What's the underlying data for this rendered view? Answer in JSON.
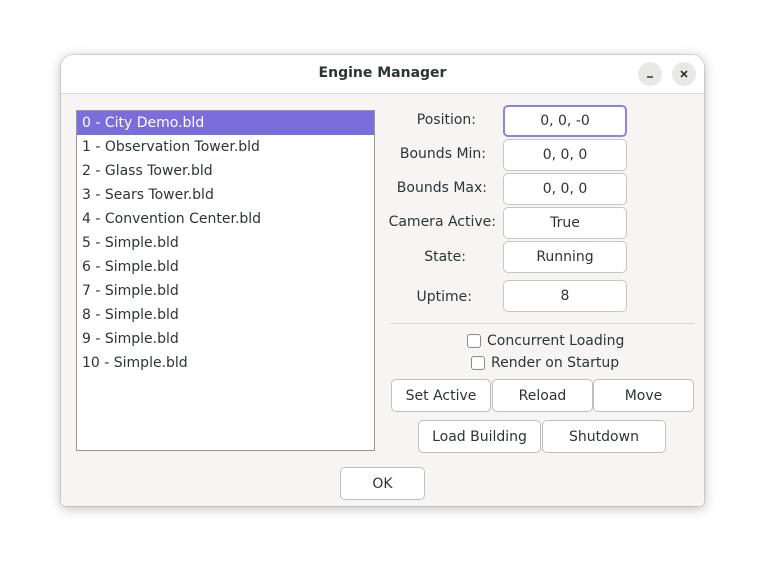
{
  "window": {
    "title": "Engine Manager",
    "minimize_icon": "minimize-icon",
    "close_icon": "close-icon"
  },
  "buildings": [
    "0 - City Demo.bld",
    "1 - Observation Tower.bld",
    "2 - Glass Tower.bld",
    "3 - Sears Tower.bld",
    "4 - Convention Center.bld",
    "5 - Simple.bld",
    "6 - Simple.bld",
    "7 - Simple.bld",
    "8 - Simple.bld",
    "9 - Simple.bld",
    "10 - Simple.bld"
  ],
  "selected_index": 0,
  "properties": {
    "position": {
      "label": "Position:",
      "value": "0, 0, -0"
    },
    "bounds_min": {
      "label": "Bounds Min:",
      "value": "0, 0, 0"
    },
    "bounds_max": {
      "label": "Bounds Max:",
      "value": "0, 0, 0"
    },
    "camera_active": {
      "label": "Camera Active:",
      "value": "True"
    },
    "state": {
      "label": "State:",
      "value": "Running"
    },
    "uptime": {
      "label": "Uptime:",
      "value": "8"
    }
  },
  "options": {
    "concurrent_loading": {
      "label": "Concurrent Loading",
      "checked": false
    },
    "render_on_startup": {
      "label": "Render on Startup",
      "checked": false
    }
  },
  "buttons": {
    "set_active": "Set Active",
    "reload": "Reload",
    "move": "Move",
    "load_building": "Load Building",
    "shutdown": "Shutdown",
    "ok": "OK"
  },
  "colors": {
    "selection": "#7c6ddc",
    "focus_border": "#8d82e0"
  }
}
